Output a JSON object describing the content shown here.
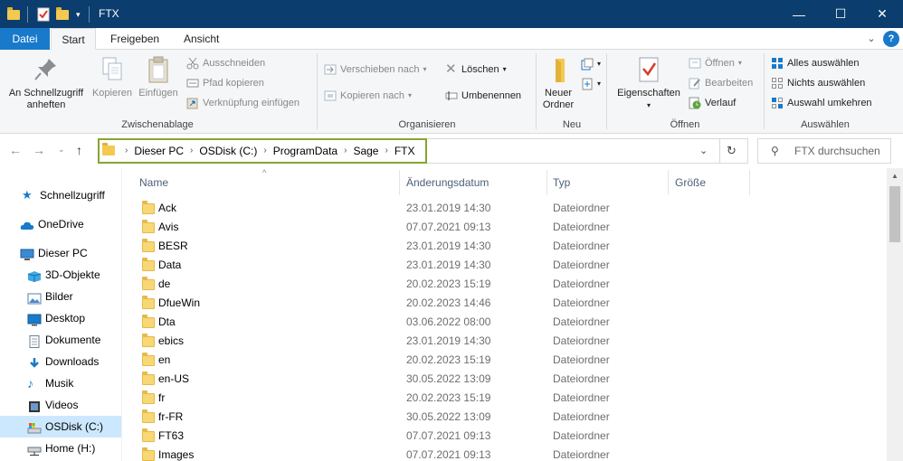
{
  "window": {
    "title": "FTX"
  },
  "tabs": [
    {
      "label": "Datei"
    },
    {
      "label": "Start"
    },
    {
      "label": "Freigeben"
    },
    {
      "label": "Ansicht"
    }
  ],
  "ribbon": {
    "clipboard": {
      "group_label": "Zwischenablage",
      "pin_label": "An Schnellzugriff anheften",
      "copy_label": "Kopieren",
      "paste_label": "Einfügen",
      "cut_label": "Ausschneiden",
      "copy_path_label": "Pfad kopieren",
      "paste_shortcut_label": "Verknüpfung einfügen"
    },
    "organize": {
      "group_label": "Organisieren",
      "move_to_label": "Verschieben nach",
      "copy_to_label": "Kopieren nach",
      "delete_label": "Löschen",
      "rename_label": "Umbenennen"
    },
    "new": {
      "group_label": "Neu",
      "new_folder_label": "Neuer Ordner"
    },
    "open": {
      "group_label": "Öffnen",
      "properties_label": "Eigenschaften",
      "open_label": "Öffnen",
      "edit_label": "Bearbeiten",
      "history_label": "Verlauf"
    },
    "select": {
      "group_label": "Auswählen",
      "select_all_label": "Alles auswählen",
      "select_none_label": "Nichts auswählen",
      "invert_label": "Auswahl umkehren"
    }
  },
  "address": {
    "crumbs": [
      "Dieser PC",
      "OSDisk (C:)",
      "ProgramData",
      "Sage",
      "FTX"
    ],
    "search_placeholder": "FTX durchsuchen"
  },
  "navpane": {
    "items": [
      {
        "label": "Schnellzugriff",
        "icon": "star-icon"
      },
      {
        "label": "OneDrive",
        "icon": "cloud-icon"
      },
      {
        "label": "Dieser PC",
        "icon": "computer-icon"
      },
      {
        "label": "3D-Objekte",
        "icon": "cube-icon"
      },
      {
        "label": "Bilder",
        "icon": "pictures-icon"
      },
      {
        "label": "Desktop",
        "icon": "desktop-icon"
      },
      {
        "label": "Dokumente",
        "icon": "documents-icon"
      },
      {
        "label": "Downloads",
        "icon": "download-icon"
      },
      {
        "label": "Musik",
        "icon": "music-icon"
      },
      {
        "label": "Videos",
        "icon": "video-icon"
      },
      {
        "label": "OSDisk (C:)",
        "icon": "drive-icon"
      },
      {
        "label": "Home (H:)",
        "icon": "network-drive-icon"
      }
    ],
    "selected": "OSDisk (C:)"
  },
  "filelist": {
    "columns": [
      "Name",
      "Änderungsdatum",
      "Typ",
      "Größe"
    ],
    "rows": [
      {
        "name": "Ack",
        "date": "23.01.2019 14:30",
        "type": "Dateiordner"
      },
      {
        "name": "Avis",
        "date": "07.07.2021 09:13",
        "type": "Dateiordner"
      },
      {
        "name": "BESR",
        "date": "23.01.2019 14:30",
        "type": "Dateiordner"
      },
      {
        "name": "Data",
        "date": "23.01.2019 14:30",
        "type": "Dateiordner"
      },
      {
        "name": "de",
        "date": "20.02.2023 15:19",
        "type": "Dateiordner"
      },
      {
        "name": "DfueWin",
        "date": "20.02.2023 14:46",
        "type": "Dateiordner"
      },
      {
        "name": "Dta",
        "date": "03.06.2022 08:00",
        "type": "Dateiordner"
      },
      {
        "name": "ebics",
        "date": "23.01.2019 14:30",
        "type": "Dateiordner"
      },
      {
        "name": "en",
        "date": "20.02.2023 15:19",
        "type": "Dateiordner"
      },
      {
        "name": "en-US",
        "date": "30.05.2022 13:09",
        "type": "Dateiordner"
      },
      {
        "name": "fr",
        "date": "20.02.2023 15:19",
        "type": "Dateiordner"
      },
      {
        "name": "fr-FR",
        "date": "30.05.2022 13:09",
        "type": "Dateiordner"
      },
      {
        "name": "FT63",
        "date": "07.07.2021 09:13",
        "type": "Dateiordner"
      },
      {
        "name": "Images",
        "date": "07.07.2021 09:13",
        "type": "Dateiordner"
      }
    ]
  },
  "colors": {
    "titlebar": "#0b3d6e",
    "file_tab": "#1979ca",
    "address_highlight": "#86a52f",
    "folder": "#f8d775",
    "selection": "#cce8ff"
  }
}
